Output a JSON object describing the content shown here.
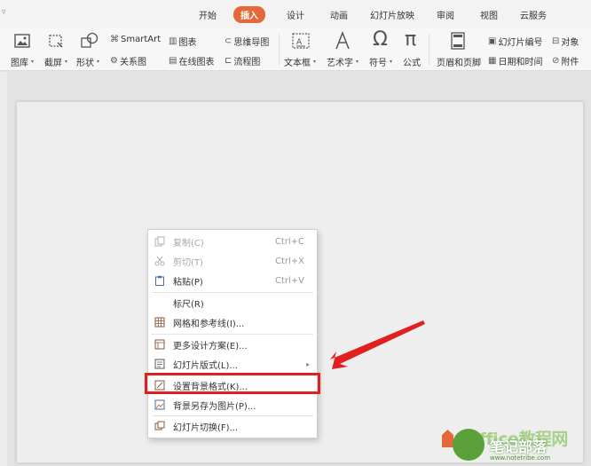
{
  "tabs": [
    "开始",
    "插入",
    "设计",
    "动画",
    "幻灯片放映",
    "审阅",
    "视图",
    "云服务"
  ],
  "active_tab": "插入",
  "quick_access_icon": "chevron-down-icon",
  "ribbon": {
    "picture": "图库",
    "screenshot": "截屏",
    "shapes": "形状",
    "smartart": "SmartArt",
    "chart": "图表",
    "mindmap": "思维导图",
    "relation": "关系图",
    "online_chart": "在线图表",
    "flowchart": "流程图",
    "textbox": "文本框",
    "wordart": "艺术字",
    "symbol": "符号",
    "formula": "公式",
    "header_footer": "页眉和页脚",
    "slide_number": "幻灯片编号",
    "object": "对象",
    "datetime": "日期和时间",
    "attachment": "附件"
  },
  "context_menu": {
    "items": [
      {
        "label": "复制(C)",
        "shortcut": "Ctrl+C",
        "disabled": true,
        "icon": "copy-icon"
      },
      {
        "label": "剪切(T)",
        "shortcut": "Ctrl+X",
        "disabled": true,
        "icon": "cut-icon"
      },
      {
        "label": "粘贴(P)",
        "shortcut": "Ctrl+V",
        "disabled": false,
        "icon": "paste-icon"
      },
      {
        "label": "标尺(R)",
        "shortcut": "",
        "disabled": false,
        "icon": ""
      },
      {
        "label": "网格和参考线(I)...",
        "shortcut": "",
        "disabled": false,
        "icon": "grid-icon"
      },
      {
        "label": "更多设计方案(E)...",
        "shortcut": "",
        "disabled": false,
        "icon": "design-icon"
      },
      {
        "label": "幻灯片版式(L)...",
        "shortcut": "",
        "disabled": false,
        "icon": "layout-icon",
        "submenu": true
      },
      {
        "label": "设置背景格式(K)...",
        "shortcut": "",
        "disabled": false,
        "icon": "background-format-icon",
        "highlighted": true
      },
      {
        "label": "背景另存为图片(P)...",
        "shortcut": "",
        "disabled": false,
        "icon": "save-image-icon"
      },
      {
        "label": "幻灯片切换(F)...",
        "shortcut": "",
        "disabled": false,
        "icon": "transition-icon"
      }
    ]
  },
  "watermark": {
    "brand": "Office教程网",
    "title": "笔记部落",
    "url": "www.notetribe.com"
  },
  "colors": {
    "accent": "#e4693a",
    "highlight_box": "#e02020",
    "arrow": "#e02020",
    "watermark_green": "#5aa13c"
  }
}
